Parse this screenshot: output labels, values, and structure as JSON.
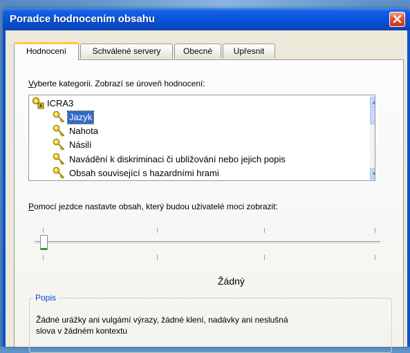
{
  "window": {
    "title": "Poradce hodnocením obsahu"
  },
  "tabs": [
    {
      "label": "Hodnocení",
      "active": true
    },
    {
      "label": "Schválené servery",
      "active": false
    },
    {
      "label": "Obecné",
      "active": false
    },
    {
      "label": "Upřesnit",
      "active": false
    }
  ],
  "category_prompt": {
    "mnemonic": "V",
    "rest": "yberte kategorii. Zobrazí se úroveň hodnocení:"
  },
  "categories": {
    "root": "ICRA3",
    "items": [
      "Jazyk",
      "Nahota",
      "Násilí",
      "Navádění k diskriminaci či ubližování nebo jejich popis",
      "Obsah související s hazardními hrami"
    ],
    "selected": "Jazyk"
  },
  "slider_prompt": {
    "mnemonic": "P",
    "rest": "omocí jezdce nastavte obsah, který budou uživatelé moci zobrazit:"
  },
  "slider": {
    "level_label": "Žádný",
    "position": 0,
    "tick_count": 4
  },
  "description": {
    "title": "Popis",
    "line1": "Žádné urážky ani vulgámí výrazy, žádné klení, nadávky ani neslušná",
    "line2": "slova v žádném kontextu"
  },
  "colors": {
    "titlebar": "#0a56db",
    "selection": "#316ac5",
    "close_button": "#e3532e",
    "dialog_face": "#ece9d8",
    "group_title": "#0046d5",
    "slider_thumb_accent": "#21a121"
  },
  "icons": {
    "root": "key-lock-icon",
    "item": "key-icon",
    "close": "close-icon"
  }
}
